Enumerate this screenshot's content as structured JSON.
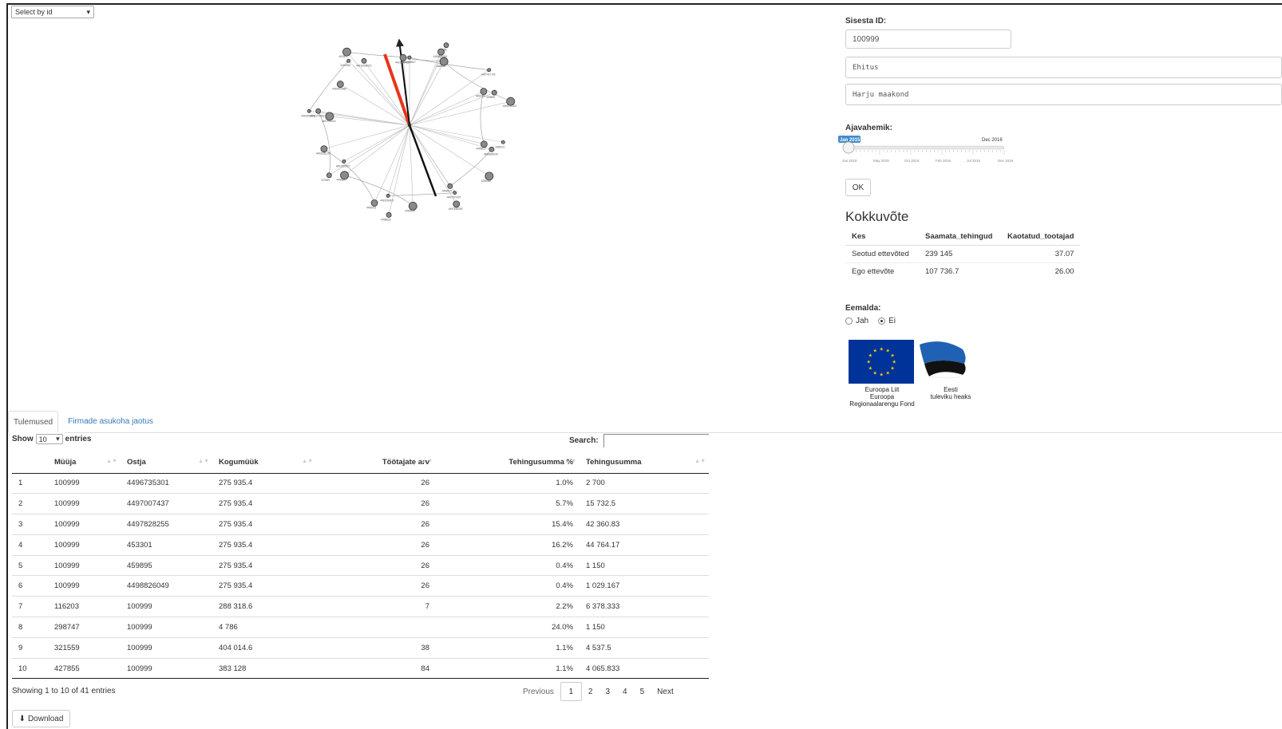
{
  "select_by_id": {
    "label": "Select by id"
  },
  "right_panel": {
    "id_label": "Sisesta ID:",
    "id_value": "100999",
    "sector_value": "Ehitus",
    "county_value": "Harju maakond",
    "period_label": "Ajavahemik:",
    "slider": {
      "current_label": "Jan 2015",
      "end_label": "Dec 2016",
      "ticks": [
        "Jan 2015",
        "May 2015",
        "Oct 2015",
        "Feb 2016",
        "Jul 2016",
        "Dec 2016"
      ],
      "accent": "#428bca"
    },
    "ok_label": "OK",
    "summary_title": "Kokkuvõte",
    "summary_table": {
      "headers": [
        "Kes",
        "Saamata_tehingud",
        "Kaotatud_tootajad"
      ],
      "rows": [
        [
          "Seotud ettevõted",
          "239 145",
          "37.07"
        ],
        [
          "Ego ettevõte",
          "107 736.7",
          "26.00"
        ]
      ]
    },
    "remove_label": "Eemalda:",
    "radio_yes": "Jah",
    "radio_no": "Ei",
    "eu_text": [
      "Euroopa Liit",
      "Euroopa",
      "Regionaalarengu Fond"
    ],
    "est_text": [
      "Eesti",
      "tuleviku heaks"
    ]
  },
  "tabs": {
    "results": "Tulemused",
    "location": "Firmade asukoha jaotus"
  },
  "table_controls": {
    "show": "Show",
    "entries_value": "10",
    "entries": "entries",
    "search": "Search:"
  },
  "results_table": {
    "headers": [
      "",
      "Müüja",
      "Ostja",
      "Kogumüük",
      "",
      "Töötajate arv",
      "Tehingusumma %",
      "Tehingusumma"
    ],
    "rows": [
      [
        "1",
        "100999",
        "4496735301",
        "275 935.4",
        "26",
        "1.0%",
        "2 700"
      ],
      [
        "2",
        "100999",
        "4497007437",
        "275 935.4",
        "26",
        "5.7%",
        "15 732.5"
      ],
      [
        "3",
        "100999",
        "4497828255",
        "275 935.4",
        "26",
        "15.4%",
        "42 360.83"
      ],
      [
        "4",
        "100999",
        "453301",
        "275 935.4",
        "26",
        "16.2%",
        "44 764.17"
      ],
      [
        "5",
        "100999",
        "459895",
        "275 935.4",
        "26",
        "0.4%",
        "1 150"
      ],
      [
        "6",
        "100999",
        "4498826049",
        "275 935.4",
        "26",
        "0.4%",
        "1 029.167"
      ],
      [
        "7",
        "116203",
        "100999",
        "288 318.6",
        "7",
        "2.2%",
        "6 378.333"
      ],
      [
        "8",
        "298747",
        "100999",
        "4 786",
        "",
        "24.0%",
        "1 150"
      ],
      [
        "9",
        "321559",
        "100999",
        "404 014.6",
        "38",
        "1.1%",
        "4 537.5"
      ],
      [
        "10",
        "427855",
        "100999",
        "383 128",
        "84",
        "1.1%",
        "4 065.833"
      ]
    ]
  },
  "table_footer": {
    "info": "Showing 1 to 10 of 41 entries",
    "previous": "Previous",
    "pages": [
      "1",
      "2",
      "3",
      "4",
      "5"
    ],
    "next": "Next"
  },
  "download_label": "Download",
  "graph": {
    "nodes": [
      {
        "id": "4491998847"
      },
      {
        "id": "448190"
      },
      {
        "id": "4488826049"
      },
      {
        "id": "4489821"
      },
      {
        "id": "4497427742"
      },
      {
        "id": "459895"
      },
      {
        "id": "4496451"
      },
      {
        "id": "4496735301"
      },
      {
        "id": "4486221"
      },
      {
        "id": "4498826049"
      },
      {
        "id": "4499822"
      },
      {
        "id": "4496452"
      },
      {
        "id": "4497007437"
      },
      {
        "id": "4498427"
      },
      {
        "id": "4497828255"
      },
      {
        "id": "4495454"
      },
      {
        "id": "4491993421"
      },
      {
        "id": "4498826"
      },
      {
        "id": "4496421"
      },
      {
        "id": "4498841"
      },
      {
        "id": "4491993427"
      },
      {
        "id": "327559"
      },
      {
        "id": "4493028135"
      },
      {
        "id": "4491993414"
      },
      {
        "id": "4491993423"
      },
      {
        "id": "4491274563"
      },
      {
        "id": "4491993489"
      },
      {
        "id": "453301"
      },
      {
        "id": "4494526"
      },
      {
        "id": "4491993427b"
      },
      {
        "id": "4491993433"
      }
    ],
    "node_color": "#8a8a8a",
    "edge_color": "#bbbbbb",
    "highlight_red": "#e8351a",
    "highlight_black": "#111111"
  }
}
